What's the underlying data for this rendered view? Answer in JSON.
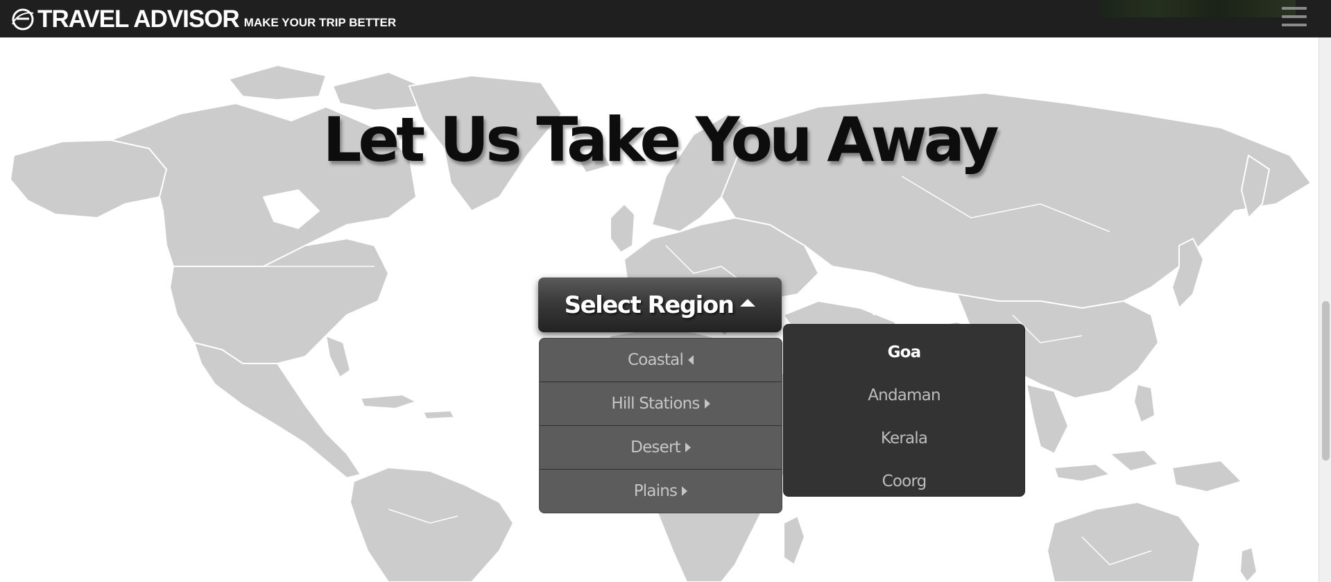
{
  "header": {
    "brand_name": "TRAVEL ADVISOR",
    "tagline": "MAKE YOUR TRIP BETTER",
    "menu_icon": "hamburger-menu-icon",
    "logo_icon": "globe-e-logo-icon"
  },
  "hero": {
    "headline": "Let Us Take You Away"
  },
  "region_selector": {
    "label": "Select Region",
    "caret_icon": "caret-up-icon",
    "regions": [
      {
        "label": "Coastal",
        "caret": "caret-left-icon"
      },
      {
        "label": "Hill Stations",
        "caret": "caret-right-icon"
      },
      {
        "label": "Desert",
        "caret": "caret-right-icon"
      },
      {
        "label": "Plains",
        "caret": "caret-right-icon"
      }
    ],
    "sub_menu": {
      "items": [
        "Goa",
        "Andaman",
        "Kerala",
        "Coorg"
      ],
      "active_item": "Goa"
    }
  },
  "colors": {
    "header_bg": "#1f1f1f",
    "map_land": "#cccccc",
    "map_borders": "#ffffff",
    "button_bg": "#3a3a3a",
    "menu_bg": "#5c5c5c",
    "submenu_bg": "#333333",
    "text_white": "#ffffff",
    "text_muted": "#c6c6c6"
  }
}
